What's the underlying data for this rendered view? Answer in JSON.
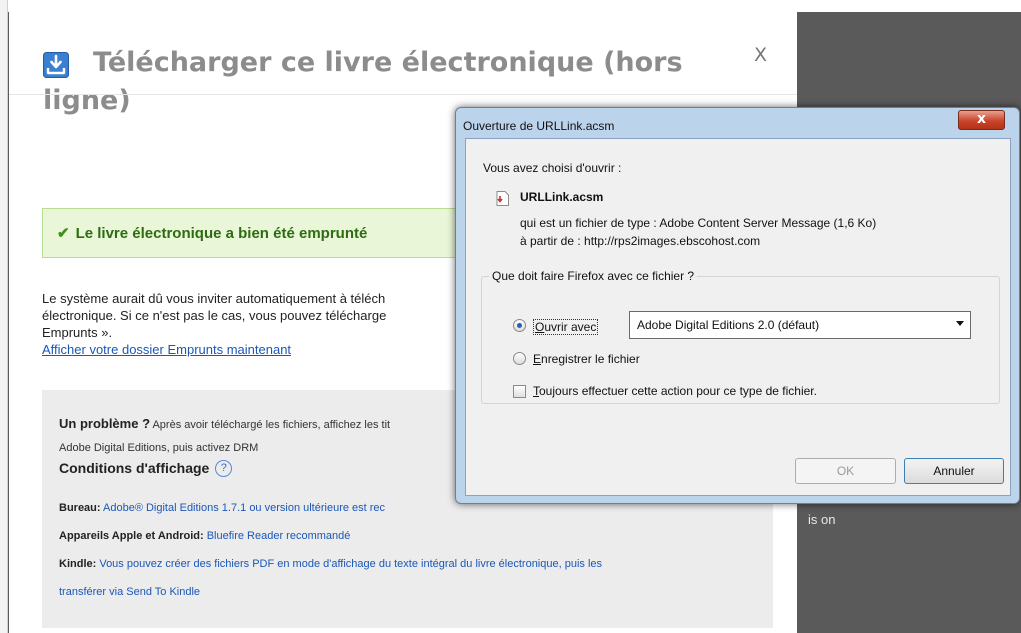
{
  "backdrop": {
    "partial_text": "is on"
  },
  "ebook_dialog": {
    "title": "Télécharger ce livre électronique (hors ligne)",
    "close_label": "X",
    "success_message": "Le livre électronique a bien été emprunté",
    "info_line1": "Le système aurait dû vous inviter automatiquement à téléch",
    "info_line2": "électronique. Si ce n'est pas le cas, vous pouvez télécharge",
    "info_line3": "Emprunts ».",
    "info_link": "Afficher votre dossier Emprunts maintenant",
    "help": {
      "problem_label": "Un problème ?",
      "problem_text": " Après avoir téléchargé les fichiers, affichez les tit",
      "problem_text2": "Adobe Digital Editions, puis activez DRM",
      "conditions_title": "Conditions d'affichage",
      "help_icon_glyph": "?",
      "desktop_label": "Bureau:",
      "desktop_text": " Adobe® Digital Editions 1.7.1 ou version ultérieure est rec",
      "apple_label": "Appareils Apple et Android:",
      "apple_text": " Bluefire Reader recommandé",
      "kindle_label": "Kindle:",
      "kindle_text": " Vous pouvez créer des fichiers PDF en mode d'affichage du texte intégral du livre électronique, puis les",
      "kindle_text2": "transférer via Send To Kindle"
    }
  },
  "firefox_dialog": {
    "title": "Ouverture de URLLink.acsm",
    "close_glyph": "x",
    "chosen_label": "Vous avez choisi d'ouvrir :",
    "file_name": "URLLink.acsm",
    "type_line": "qui est un fichier de type : Adobe Content Server Message (1,6 Ko)",
    "from_line": "à partir de : http://rps2images.ebscohost.com",
    "question": "Que doit faire Firefox avec ce fichier ?",
    "open_with_label": "Ouvrir avec",
    "open_with_value": "Adobe Digital Editions 2.0 (défaut)",
    "save_label": "Enregistrer le fichier",
    "always_label": "Toujours effectuer cette action pour ce type de fichier.",
    "ok_label": "OK",
    "cancel_label": "Annuler"
  }
}
